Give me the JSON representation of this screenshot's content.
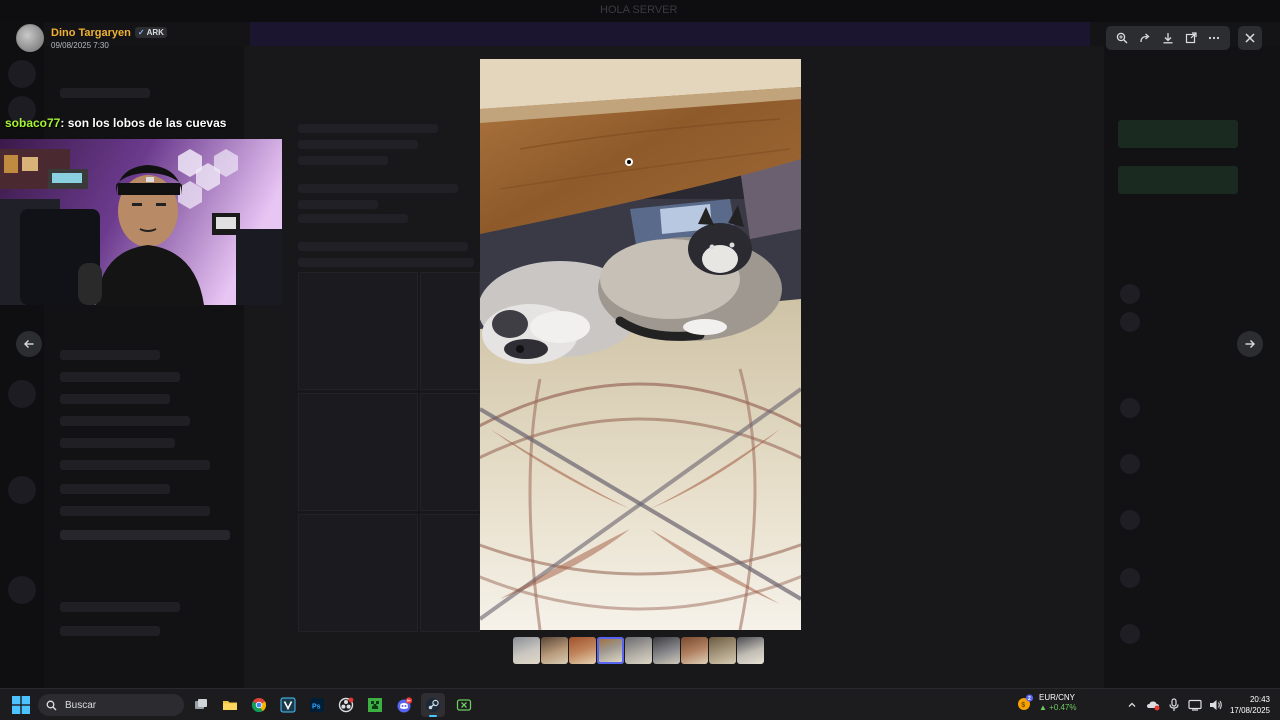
{
  "background": {
    "window_title": "HOLA SERVER"
  },
  "uploader": {
    "name": "Dino Targaryen",
    "tag": "ARK",
    "timestamp": "09/08/2025 7:30"
  },
  "toolbar": {
    "icons": [
      "zoom-in-icon",
      "forward-icon",
      "download-icon",
      "open-external-icon",
      "more-icon"
    ],
    "close_icon": "close-icon"
  },
  "stream_overlay": {
    "chat_username": "sobaco77",
    "chat_message": ": son los lobos de las cuevas"
  },
  "viewer": {
    "thumbnail_count": 9,
    "active_thumbnail": 3
  },
  "taskbar": {
    "search_placeholder": "Buscar",
    "ticker_name": "EUR/CNY",
    "ticker_change": "+0.47%",
    "ticker_badge": "2",
    "discord_badge": "9+",
    "time": "20:43",
    "date": "17/08/2025"
  },
  "colors": {
    "accent": "#5865f2",
    "uploader_name": "#f0b232",
    "chat_username": "#a7f432",
    "ticker_up": "#6ccb5f"
  }
}
